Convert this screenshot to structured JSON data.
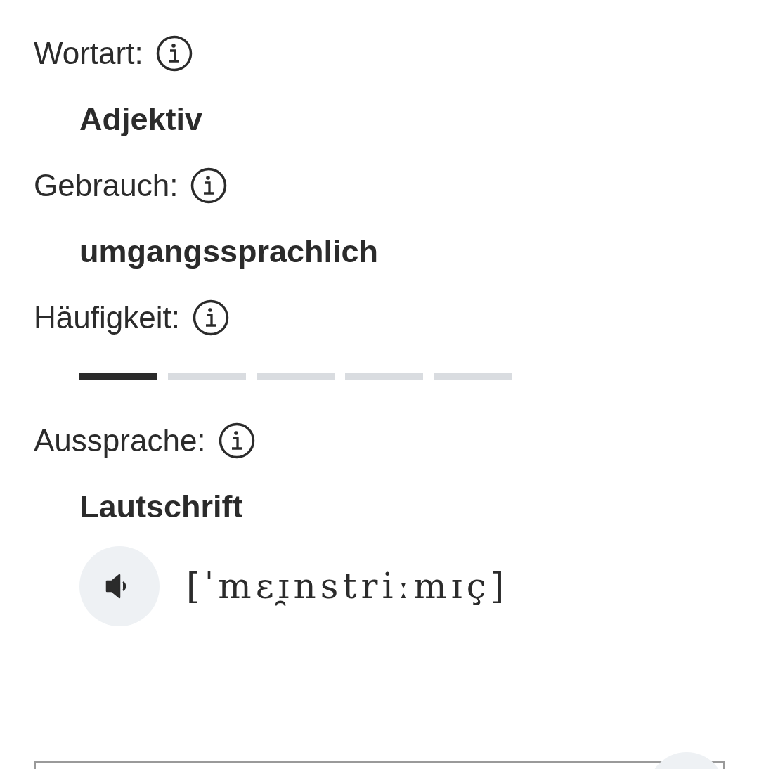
{
  "sections": [
    {
      "kind": "text",
      "label": "Wortart:",
      "value": "Adjektiv"
    },
    {
      "kind": "text",
      "label": "Gebrauch:",
      "value": "umgangssprachlich"
    },
    {
      "kind": "meter",
      "label": "Häufigkeit:",
      "segments": [
        {
          "filled": true
        },
        {
          "filled": false
        },
        {
          "filled": false
        },
        {
          "filled": false
        },
        {
          "filled": false
        }
      ]
    },
    {
      "kind": "pronunciation",
      "label": "Aussprache:",
      "heading": "Lautschrift",
      "transcription": "[ˈmɛɪ̯nstriːmɪç]"
    }
  ]
}
